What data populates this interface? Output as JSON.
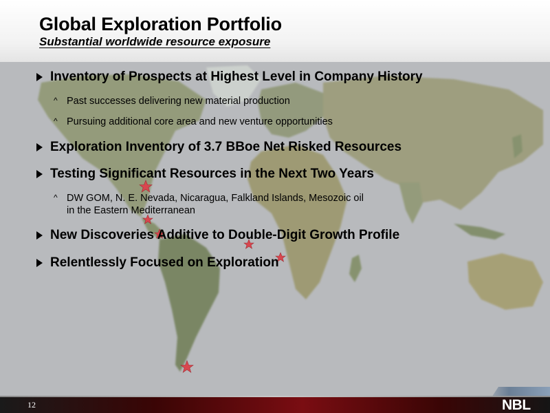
{
  "header": {
    "title": "Global Exploration Portfolio",
    "subtitle": "Substantial worldwide resource exposure"
  },
  "bullets": [
    {
      "text": "Inventory of Prospects at Highest Level in Company History"
    },
    {
      "text": "Past successes delivering new material production"
    },
    {
      "text": "Pursuing additional core area and new venture opportunities"
    },
    {
      "text": "Exploration Inventory of 3.7 BBoe Net Risked Resources"
    },
    {
      "text": "Testing Significant Resources in the Next Two Years"
    },
    {
      "text_line1": "DW GOM, N. E. Nevada, Nicaragua, Falkland Islands, Mesozoic oil",
      "text_line2": "in the Eastern Mediterranean"
    },
    {
      "text": "New Discoveries Additive to Double-Digit Growth Profile"
    },
    {
      "text": "Relentlessly Focused on Exploration"
    }
  ],
  "footer": {
    "page_number": "12",
    "logo_text": "NBL"
  },
  "colors": {
    "star": "#d9474f",
    "footer_red": "#7a0d12",
    "land": "#8f9a72",
    "ocean": "#b8babd"
  }
}
